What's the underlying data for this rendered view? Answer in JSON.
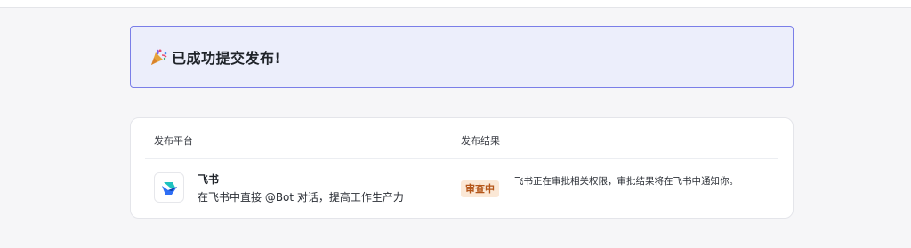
{
  "banner": {
    "icon": "party-popper-icon",
    "text": "已成功提交发布!"
  },
  "table": {
    "headers": {
      "platform": "发布平台",
      "result": "发布结果"
    },
    "rows": [
      {
        "platform_name": "飞书",
        "platform_icon": "feishu-logo-icon",
        "platform_desc": "在飞书中直接 @Bot 对话，提高工作生产力",
        "status": "审查中",
        "result_text": "飞书正在审批相关权限，审批结果将在飞书中通知你。"
      }
    ]
  },
  "colors": {
    "accent_border": "#7a7ee8",
    "banner_bg": "#eceefb",
    "badge_bg": "#fbe8d6",
    "badge_text": "#b4561a"
  }
}
